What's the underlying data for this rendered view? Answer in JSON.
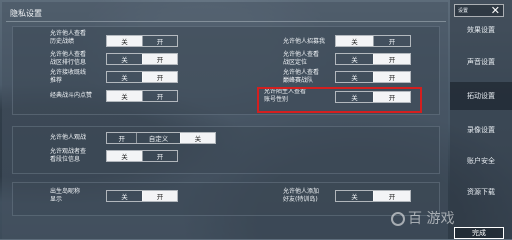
{
  "title": "隐私设置",
  "section1": {
    "rows_left": [
      {
        "label": "允许他人查看\n历史战绩",
        "off": "关",
        "on": "开",
        "selected": "关"
      },
      {
        "label": "允许他人查看\n战区排行信息",
        "off": "关",
        "on": "开",
        "selected": "开"
      },
      {
        "label": "允许接收既线\n推荐",
        "off": "关",
        "on": "开",
        "selected": "开"
      },
      {
        "label": "经典战斗内点赞",
        "off": "关",
        "on": "开",
        "selected": "关"
      }
    ],
    "rows_right": [
      {
        "label": "允许他人招募我",
        "off": "关",
        "on": "开",
        "selected": "关"
      },
      {
        "label": "允许他人查看\n战区定位",
        "off": "关",
        "on": "开",
        "selected": "开"
      },
      {
        "label": "允许他人查看\n巅峰赛战队",
        "off": "关",
        "on": "开",
        "selected": "开"
      },
      {
        "label": "允许陌生人查看\n账号性别",
        "off": "关",
        "on": "开",
        "selected": "开"
      }
    ]
  },
  "section2": {
    "spectate_label": "允许他人观战",
    "spectate_options": [
      "开",
      "自定义",
      "关"
    ],
    "spectate_selected": "关",
    "spectator_label": "允许观战者查\n看段位信息",
    "spectator_off": "关",
    "spectator_on": "开",
    "spectator_selected": "关"
  },
  "section3": {
    "birth_label": "出生岛昵称\n显示",
    "birth_off": "关",
    "birth_on": "开",
    "birth_selected": "开",
    "addfriend_label": "允许他人添加\n好友(特训岛)",
    "addfriend_off": "关",
    "addfriend_on": "开",
    "addfriend_selected": "开"
  },
  "nav": {
    "top_label": "设置",
    "items": [
      "效果设置",
      "声音设置",
      "拓动设置",
      "录像设置",
      "账户安全",
      "资源下载"
    ],
    "active_index": 2,
    "bottom_button": "完成"
  },
  "watermark": "百 游戏"
}
